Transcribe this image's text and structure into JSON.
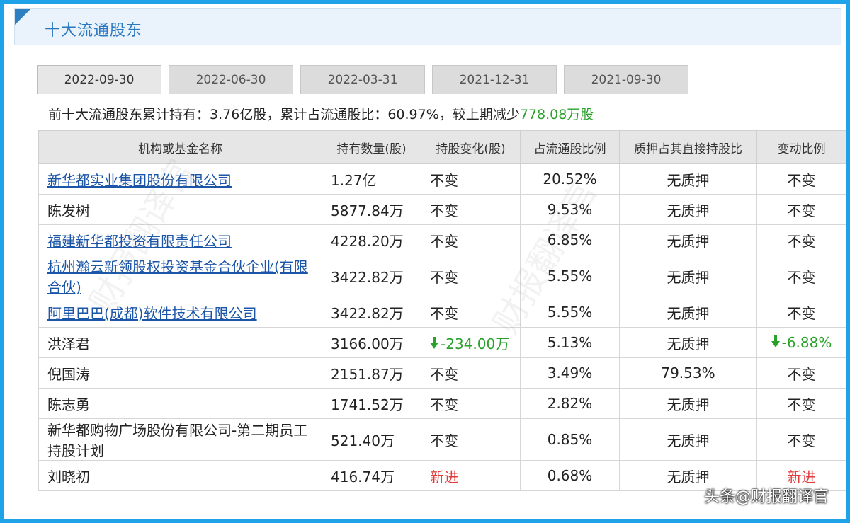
{
  "panel": {
    "title": "十大流通股东"
  },
  "tabs": [
    {
      "label": "2022-09-30",
      "active": true
    },
    {
      "label": "2022-06-30",
      "active": false
    },
    {
      "label": "2022-03-31",
      "active": false
    },
    {
      "label": "2021-12-31",
      "active": false
    },
    {
      "label": "2021-09-30",
      "active": false
    }
  ],
  "summary": {
    "prefix": "前十大流通股东累计持有：",
    "holding": "3.76亿股",
    "ratio_label": "，累计占流通股比：",
    "ratio": "60.97%",
    "change_label": "，较上期减少",
    "change": "778.08万股"
  },
  "table": {
    "headers": [
      "机构或基金名称",
      "持有数量(股)",
      "持股变化(股)",
      "占流通股比例",
      "质押占其直接持股比",
      "变动比例"
    ],
    "rows": [
      {
        "name": "新华都实业集团股份有限公司",
        "link": true,
        "qty": "1.27亿",
        "change": "不变",
        "ratio": "20.52%",
        "pledge": "无质押",
        "chg_ratio": "不变"
      },
      {
        "name": "陈发树",
        "link": false,
        "qty": "5877.84万",
        "change": "不变",
        "ratio": "9.53%",
        "pledge": "无质押",
        "chg_ratio": "不变"
      },
      {
        "name": "福建新华都投资有限责任公司",
        "link": true,
        "qty": "4228.20万",
        "change": "不变",
        "ratio": "6.85%",
        "pledge": "无质押",
        "chg_ratio": "不变"
      },
      {
        "name": "杭州瀚云新领股权投资基金合伙企业(有限合伙)",
        "link": true,
        "qty": "3422.82万",
        "change": "不变",
        "ratio": "5.55%",
        "pledge": "无质押",
        "chg_ratio": "不变"
      },
      {
        "name": "阿里巴巴(成都)软件技术有限公司",
        "link": true,
        "qty": "3422.82万",
        "change": "不变",
        "ratio": "5.55%",
        "pledge": "无质押",
        "chg_ratio": "不变"
      },
      {
        "name": "洪泽君",
        "link": false,
        "qty": "3166.00万",
        "change": "-234.00万",
        "change_down": true,
        "ratio": "5.13%",
        "pledge": "无质押",
        "chg_ratio": "-6.88%",
        "chg_ratio_down": true
      },
      {
        "name": "倪国涛",
        "link": false,
        "qty": "2151.87万",
        "change": "不变",
        "ratio": "3.49%",
        "pledge": "79.53%",
        "chg_ratio": "不变"
      },
      {
        "name": "陈志勇",
        "link": false,
        "qty": "1741.52万",
        "change": "不变",
        "ratio": "2.82%",
        "pledge": "无质押",
        "chg_ratio": "不变"
      },
      {
        "name": "新华都购物广场股份有限公司-第二期员工持股计划",
        "link": false,
        "qty": "521.40万",
        "change": "不变",
        "ratio": "0.85%",
        "pledge": "无质押",
        "chg_ratio": "不变"
      },
      {
        "name": "刘晓初",
        "link": false,
        "qty": "416.74万",
        "change": "新进",
        "change_new": true,
        "ratio": "0.68%",
        "pledge": "无质押",
        "chg_ratio": "新进"
      }
    ]
  },
  "watermark": "财报翻译官",
  "footer": "头条@财报翻译官",
  "colors": {
    "frame": "#1fa3e8",
    "title": "#2b78c2",
    "link": "#1a55a8",
    "down": "#2aa12a",
    "new": "#e33b3b"
  }
}
